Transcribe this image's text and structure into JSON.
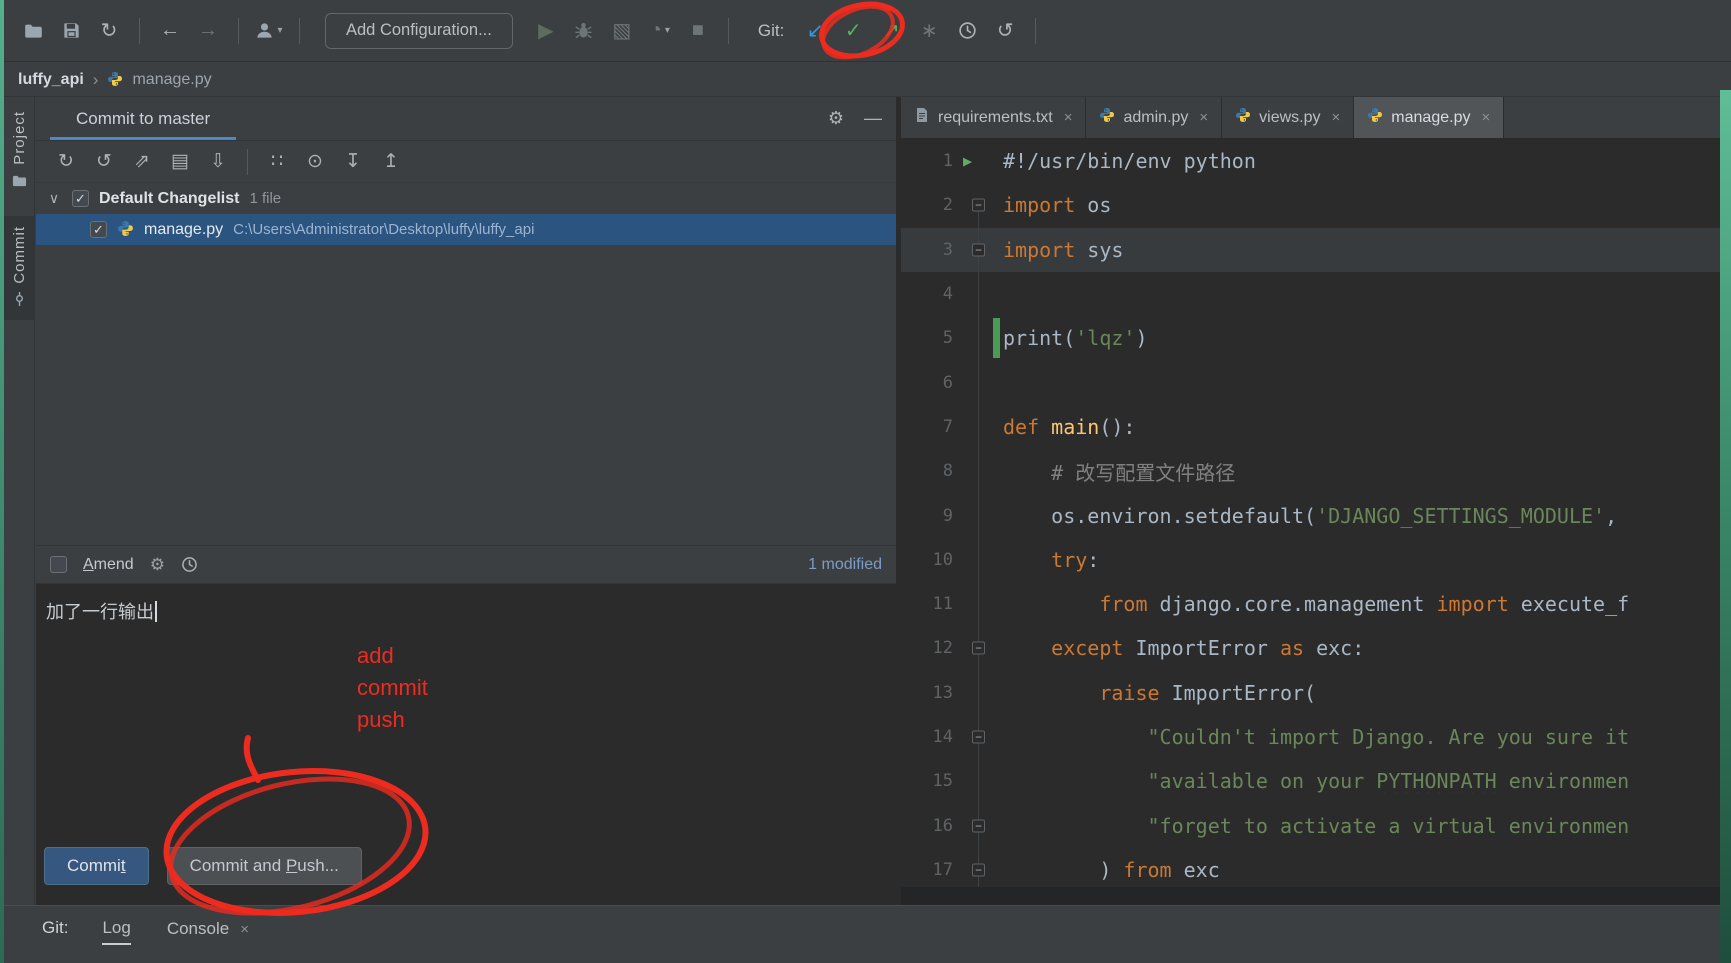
{
  "colors": {
    "annotation_red": "#ee2b1f",
    "selection_blue": "#2b5480",
    "button_blue": "#365880",
    "tab_underline_blue": "#4a88c7"
  },
  "main_toolbar": {
    "dropdown_glyph": "▾",
    "left_icons": [
      {
        "name": "open-project-icon",
        "glyph": "folder"
      },
      {
        "name": "save-all-icon",
        "glyph": "floppy"
      },
      {
        "name": "synchronize-icon",
        "glyph": "↻",
        "color": "#afb1b3"
      },
      {
        "name": "separator"
      },
      {
        "name": "back-icon",
        "glyph": "←",
        "color": "#afb1b3"
      },
      {
        "name": "forward-icon",
        "glyph": "→",
        "color": "#6e7577"
      },
      {
        "name": "separator"
      },
      {
        "name": "user-icon",
        "glyph": "person",
        "dropdown": true
      },
      {
        "name": "separator"
      }
    ],
    "add_configuration_label": "Add Configuration...",
    "run_icons": [
      {
        "name": "run-icon",
        "glyph": "▶",
        "color": "#5e6b5e"
      },
      {
        "name": "debug-icon",
        "glyph": "bug"
      },
      {
        "name": "coverage-icon",
        "glyph": "▧",
        "color": "#6e7577"
      },
      {
        "name": "profiler-icon",
        "glyph": "◔",
        "color": "#6e7577",
        "dropdown": true
      },
      {
        "name": "stop-icon",
        "glyph": "■",
        "color": "#6e7577"
      },
      {
        "name": "separator"
      }
    ],
    "git_label": "Git:",
    "git_icons": [
      {
        "name": "git-update-icon",
        "glyph": "↙",
        "color": "#3d94d9"
      },
      {
        "name": "git-commit-icon",
        "glyph": "✓",
        "color": "#57b45c"
      },
      {
        "name": "git-push-icon",
        "glyph": "↗",
        "color": "#57b45c"
      },
      {
        "name": "git-cherry-pick-icon",
        "glyph": "∗",
        "color": "#6e7577"
      },
      {
        "name": "git-history-icon",
        "glyph": "clock"
      },
      {
        "name": "git-rollback-icon",
        "glyph": "↺",
        "color": "#afb1b3"
      },
      {
        "name": "separator"
      }
    ]
  },
  "breadcrumb": {
    "project": "luffy_api",
    "separator": "›",
    "file": "manage.py"
  },
  "tool_strip": {
    "items": [
      {
        "name": "project",
        "label": "Project",
        "icon": "folder",
        "active": false
      },
      {
        "name": "commit",
        "label": "Commit",
        "icon": "commit-node",
        "active": true
      }
    ]
  },
  "commit_panel": {
    "tab_title": "Commit to master",
    "header_icons": [
      {
        "name": "settings-gear-icon",
        "glyph": "⚙",
        "color": "#afb1b3"
      },
      {
        "name": "hide-panel-icon",
        "glyph": "—",
        "color": "#afb1b3"
      }
    ],
    "toolbar_icons": [
      {
        "name": "refresh-changes-icon",
        "glyph": "↻",
        "color": "#afb1b3"
      },
      {
        "name": "rollback-icon",
        "glyph": "↺",
        "color": "#afb1b3"
      },
      {
        "name": "shelve-icon",
        "glyph": "⇗",
        "color": "#afb1b3"
      },
      {
        "name": "changelist-icon",
        "glyph": "▤",
        "color": "#afb1b3"
      },
      {
        "name": "unshelve-icon",
        "glyph": "⇩",
        "color": "#afb1b3"
      },
      {
        "name": "separator"
      },
      {
        "name": "group-by-icon",
        "glyph": "∷",
        "color": "#afb1b3"
      },
      {
        "name": "preview-diff-icon",
        "glyph": "⊙",
        "color": "#afb1b3"
      },
      {
        "name": "expand-all-icon",
        "glyph": "↧",
        "color": "#afb1b3"
      },
      {
        "name": "collapse-all-icon",
        "glyph": "↥",
        "color": "#afb1b3"
      }
    ],
    "changelist": {
      "chevron": "∨",
      "name": "Default Changelist",
      "count": "1 file"
    },
    "file_row": {
      "name": "manage.py",
      "path": "C:\\Users\\Administrator\\Desktop\\luffy\\luffy_api"
    },
    "amend_row": {
      "label": "Amend",
      "icons": [
        {
          "name": "commit-options-gear-icon",
          "glyph": "⚙",
          "color": "#9da1a4"
        },
        {
          "name": "history-icon",
          "glyph": "clock"
        }
      ],
      "modified_label": "1 modified"
    },
    "commit_message": "加了一行输出",
    "commit_button": {
      "pre": "Commi",
      "mnemonic": "t",
      "post": ""
    },
    "commit_push_button": {
      "pre": "Commit and ",
      "mnemonic": "P",
      "post": "ush..."
    }
  },
  "annotations": {
    "note_lines": [
      "add",
      "commit",
      "push"
    ]
  },
  "editor": {
    "close_glyph": "×",
    "run_glyph": "▶",
    "fold_glyph": "−",
    "tabs": [
      {
        "label": "requirements.txt",
        "icon": "text-file",
        "active": false
      },
      {
        "label": "admin.py",
        "icon": "python",
        "active": false
      },
      {
        "label": "views.py",
        "icon": "python",
        "active": false
      },
      {
        "label": "manage.py",
        "icon": "python",
        "active": true
      }
    ],
    "lines": [
      {
        "n": 1,
        "run": true,
        "tokens": [
          {
            "t": "#!/usr/bin/env python",
            "c": "d"
          }
        ]
      },
      {
        "n": 2,
        "fold": true,
        "tokens": [
          {
            "t": "import",
            "c": "k"
          },
          {
            "t": " os",
            "c": "d"
          }
        ]
      },
      {
        "n": 3,
        "fold": true,
        "caret": true,
        "tokens": [
          {
            "t": "import",
            "c": "k"
          },
          {
            "t": " sys",
            "c": "d"
          }
        ]
      },
      {
        "n": 4,
        "tokens": []
      },
      {
        "n": 5,
        "changed": true,
        "tokens": [
          {
            "t": "print",
            "c": "d"
          },
          {
            "t": "(",
            "c": "d"
          },
          {
            "t": "'lqz'",
            "c": "s"
          },
          {
            "t": ")",
            "c": "d"
          }
        ]
      },
      {
        "n": 6,
        "tokens": []
      },
      {
        "n": 7,
        "tokens": [
          {
            "t": "def ",
            "c": "k",
            "u": 1
          },
          {
            "t": "main",
            "c": "f",
            "u": 1
          },
          {
            "t": "():",
            "c": "d",
            "u": 1
          }
        ]
      },
      {
        "n": 8,
        "tokens": [
          {
            "t": "    # 改写配置文件路径",
            "c": "c"
          }
        ]
      },
      {
        "n": 9,
        "tokens": [
          {
            "t": "    os.environ.setdefault(",
            "c": "d"
          },
          {
            "t": "'DJANGO_SETTINGS_MODULE'",
            "c": "s"
          },
          {
            "t": ",",
            "c": "d"
          }
        ]
      },
      {
        "n": 10,
        "tokens": [
          {
            "t": "    ",
            "c": "d"
          },
          {
            "t": "try",
            "c": "k"
          },
          {
            "t": ":",
            "c": "d"
          }
        ]
      },
      {
        "n": 11,
        "tokens": [
          {
            "t": "        ",
            "c": "d"
          },
          {
            "t": "from",
            "c": "k"
          },
          {
            "t": " django.core.management ",
            "c": "d"
          },
          {
            "t": "import",
            "c": "k"
          },
          {
            "t": " execute_f",
            "c": "d"
          }
        ]
      },
      {
        "n": 12,
        "fold": true,
        "tokens": [
          {
            "t": "    ",
            "c": "d"
          },
          {
            "t": "except",
            "c": "k"
          },
          {
            "t": " ImportError ",
            "c": "d"
          },
          {
            "t": "as",
            "c": "k"
          },
          {
            "t": " exc:",
            "c": "d"
          }
        ]
      },
      {
        "n": 13,
        "tokens": [
          {
            "t": "        ",
            "c": "d"
          },
          {
            "t": "raise",
            "c": "k"
          },
          {
            "t": " ImportError(",
            "c": "d"
          }
        ]
      },
      {
        "n": 14,
        "fold": true,
        "tokens": [
          {
            "t": "            ",
            "c": "d"
          },
          {
            "t": "\"Couldn't import Django. Are you sure it",
            "c": "s"
          }
        ]
      },
      {
        "n": 15,
        "tokens": [
          {
            "t": "            ",
            "c": "d"
          },
          {
            "t": "\"available on your ",
            "c": "s"
          },
          {
            "t": "PYTHONPATH",
            "c": "s",
            "u": 2
          },
          {
            "t": " environmen",
            "c": "s"
          }
        ]
      },
      {
        "n": 16,
        "fold": true,
        "tokens": [
          {
            "t": "            ",
            "c": "d"
          },
          {
            "t": "\"forget to activate a virtual environmen",
            "c": "s"
          }
        ]
      },
      {
        "n": 17,
        "fold": true,
        "tokens": [
          {
            "t": "        ) ",
            "c": "d"
          },
          {
            "t": "from",
            "c": "k"
          },
          {
            "t": " exc",
            "c": "d"
          }
        ]
      }
    ]
  },
  "bottom_bar": {
    "git_label": "Git:",
    "tabs": [
      {
        "label": "Log",
        "selected": true
      },
      {
        "label": "Console",
        "close": "×"
      }
    ]
  }
}
